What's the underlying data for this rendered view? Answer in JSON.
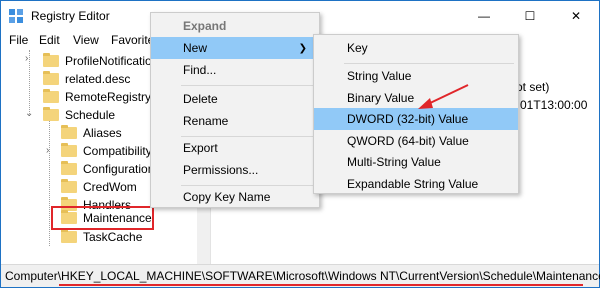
{
  "window": {
    "title": "Registry Editor",
    "minimize": "—",
    "maximize": "☐",
    "close": "✕"
  },
  "menubar": {
    "file": "File",
    "edit": "Edit",
    "view": "View",
    "favorites": "Favorite"
  },
  "tree": {
    "items": [
      {
        "label": "ProfileNotificatio"
      },
      {
        "label": "related.desc"
      },
      {
        "label": "RemoteRegistry"
      },
      {
        "label": "Schedule"
      },
      {
        "label": "Aliases"
      },
      {
        "label": "Compatibility"
      },
      {
        "label": "Configuration"
      },
      {
        "label": "CredWom"
      },
      {
        "label": "Handlers"
      },
      {
        "label": "Maintenance"
      },
      {
        "label": "TaskCache"
      }
    ]
  },
  "right_pane": {
    "frag1": "ot set)",
    "frag2": "01T13:00:00"
  },
  "context_menu": {
    "expand": "Expand",
    "new": "New",
    "find": "Find...",
    "delete": "Delete",
    "rename": "Rename",
    "export": "Export",
    "permissions": "Permissions...",
    "copy_key_name": "Copy Key Name"
  },
  "submenu": {
    "key": "Key",
    "string_value": "String Value",
    "binary_value": "Binary Value",
    "dword_value": "DWORD (32-bit) Value",
    "qword_value": "QWORD (64-bit) Value",
    "multi_string_value": "Multi-String Value",
    "expandable_string_value": "Expandable String Value"
  },
  "statusbar": {
    "path": "Computer\\HKEY_LOCAL_MACHINE\\SOFTWARE\\Microsoft\\Windows NT\\CurrentVersion\\Schedule\\Maintenance"
  },
  "colors": {
    "selection": "#91c9f7",
    "highlight_red": "#e0262a",
    "folder": "#f4d47b",
    "border": "#1e72c4"
  }
}
